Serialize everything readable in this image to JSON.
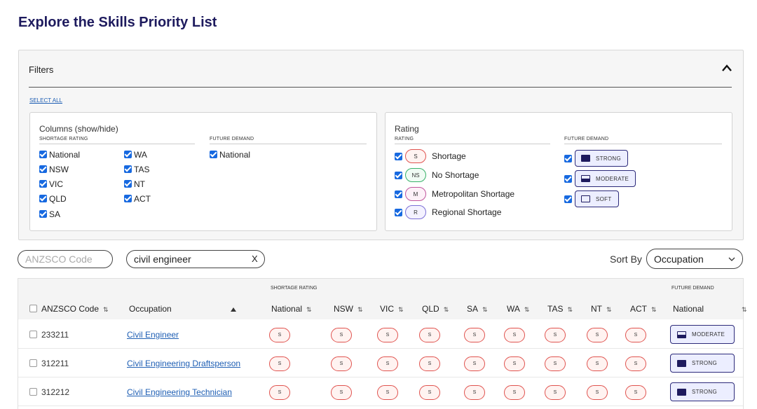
{
  "page": {
    "title": "Explore the Skills Priority List"
  },
  "filters": {
    "header": "Filters",
    "select_all": "SELECT ALL",
    "columns": {
      "title": "Columns (show/hide)",
      "shortage_rating_label": "SHORTAGE RATING",
      "future_demand_label": "FUTURE DEMAND",
      "items": [
        {
          "label": "National",
          "checked": true
        },
        {
          "label": "NSW",
          "checked": true
        },
        {
          "label": "VIC",
          "checked": true
        },
        {
          "label": "QLD",
          "checked": true
        },
        {
          "label": "SA",
          "checked": true
        },
        {
          "label": "WA",
          "checked": true
        },
        {
          "label": "TAS",
          "checked": true
        },
        {
          "label": "NT",
          "checked": true
        },
        {
          "label": "ACT",
          "checked": true
        }
      ],
      "future_demand_items": [
        {
          "label": "National",
          "checked": true
        }
      ]
    },
    "rating": {
      "title": "Rating",
      "rating_label": "RATING",
      "future_demand_label": "FUTURE DEMAND",
      "items": [
        {
          "code": "S",
          "label": "Shortage",
          "checked": true
        },
        {
          "code": "NS",
          "label": "No Shortage",
          "checked": true
        },
        {
          "code": "M",
          "label": "Metropolitan Shortage",
          "checked": true
        },
        {
          "code": "R",
          "label": "Regional Shortage",
          "checked": true
        }
      ],
      "future_demand_items": [
        {
          "label": "STRONG",
          "icon": "strong-demand-icon",
          "checked": true
        },
        {
          "label": "MODERATE",
          "icon": "moderate-demand-icon",
          "checked": true
        },
        {
          "label": "SOFT",
          "icon": "soft-demand-icon",
          "checked": true
        }
      ]
    }
  },
  "search": {
    "anzsco_placeholder": "ANZSCO Code",
    "anzsco_value": "",
    "occupation_value": "civil engineer",
    "clear_label": "X"
  },
  "sort": {
    "label": "Sort By",
    "selected": "Occupation"
  },
  "table": {
    "group_labels": {
      "shortage_rating": "SHORTAGE RATING",
      "future_demand": "FUTURE DEMAND"
    },
    "headers": {
      "anzsco": "ANZSCO Code",
      "occupation": "Occupation",
      "national": "National",
      "nsw": "NSW",
      "vic": "VIC",
      "qld": "QLD",
      "sa": "SA",
      "wa": "WA",
      "tas": "TAS",
      "nt": "NT",
      "act": "ACT",
      "future_national": "National"
    },
    "sort_icon": "⇅",
    "rows": [
      {
        "code": "233211",
        "occupation": "Civil Engineer",
        "ratings": [
          "S",
          "S",
          "S",
          "S",
          "S",
          "S",
          "S",
          "S",
          "S"
        ],
        "future": "MODERATE"
      },
      {
        "code": "312211",
        "occupation": "Civil Engineering Draftsperson",
        "ratings": [
          "S",
          "S",
          "S",
          "S",
          "S",
          "S",
          "S",
          "S",
          "S"
        ],
        "future": "STRONG"
      },
      {
        "code": "312212",
        "occupation": "Civil Engineering Technician",
        "ratings": [
          "S",
          "S",
          "S",
          "S",
          "S",
          "S",
          "S",
          "S",
          "S"
        ],
        "future": "STRONG"
      }
    ]
  },
  "colors": {
    "title": "#1e1b5e",
    "link": "#1f5fb4",
    "checkbox": "#1769e0",
    "shortage": "#e0534f",
    "demand_border": "#2c2a7a"
  }
}
